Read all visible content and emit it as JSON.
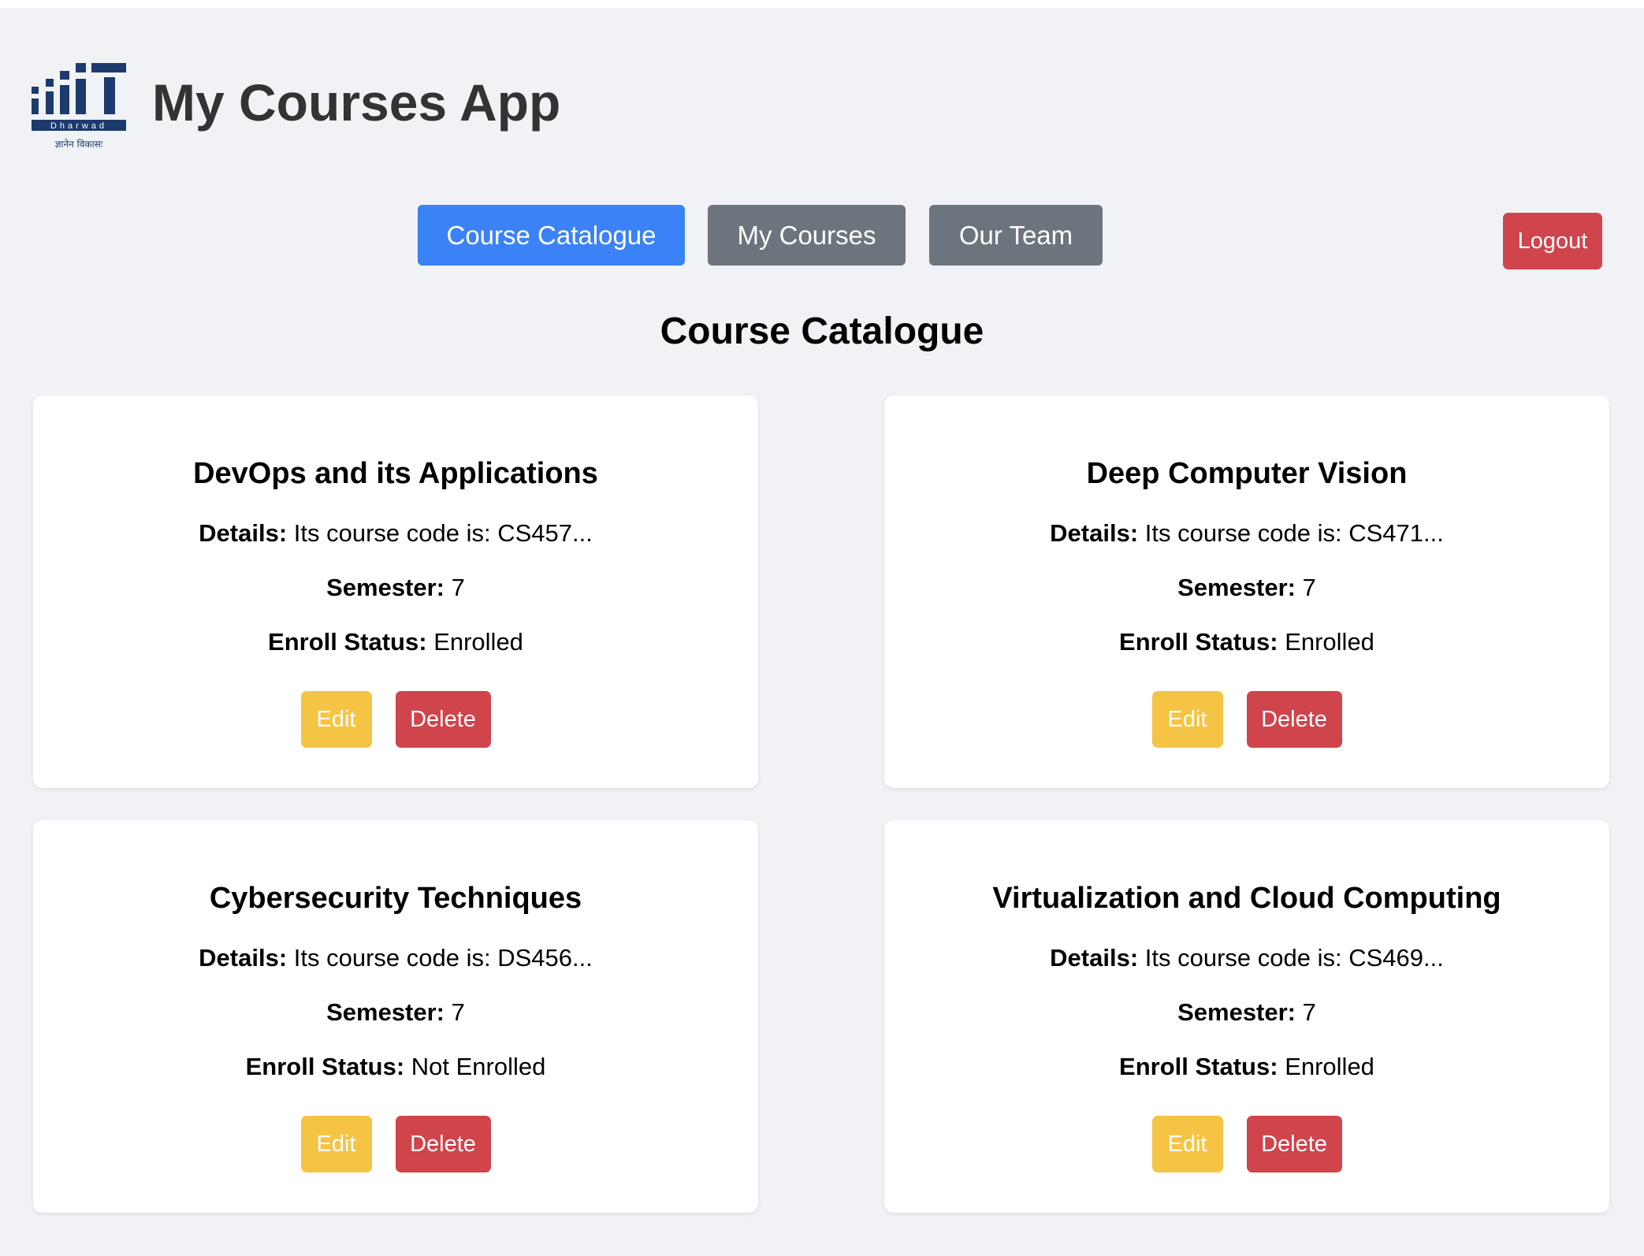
{
  "header": {
    "title": "My Courses App",
    "logo_caption": "Dharwad",
    "logo_motto": "ज्ञानेन विकासः"
  },
  "nav": {
    "items": [
      {
        "label": "Course Catalogue",
        "active": true
      },
      {
        "label": "My Courses",
        "active": false
      },
      {
        "label": "Our Team",
        "active": false
      }
    ],
    "logout_label": "Logout"
  },
  "page": {
    "heading": "Course Catalogue"
  },
  "labels": {
    "details": "Details:",
    "semester": "Semester:",
    "enroll_status": "Enroll Status:",
    "edit": "Edit",
    "delete": "Delete"
  },
  "courses": [
    {
      "title": "DevOps and its Applications",
      "details": "Its course code is: CS457...",
      "semester": "7",
      "status": "Enrolled"
    },
    {
      "title": "Deep Computer Vision",
      "details": "Its course code is: CS471...",
      "semester": "7",
      "status": "Enrolled"
    },
    {
      "title": "Cybersecurity Techniques",
      "details": "Its course code is: DS456...",
      "semester": "7",
      "status": "Not Enrolled"
    },
    {
      "title": "Virtualization and Cloud Computing",
      "details": "Its course code is: CS469...",
      "semester": "7",
      "status": "Enrolled"
    }
  ],
  "colors": {
    "primary": "#3b82f6",
    "secondary": "#6c757d",
    "danger": "#d0444c",
    "warning": "#f6c445",
    "background": "#f0f2f5",
    "logo_navy": "#1c3a6e"
  }
}
